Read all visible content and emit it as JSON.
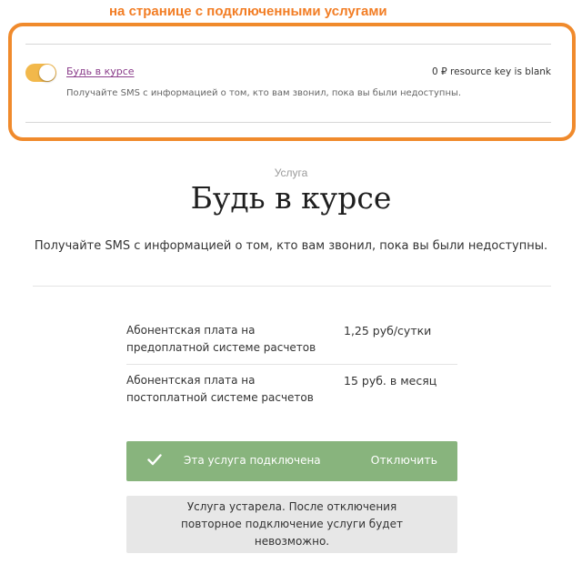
{
  "annotation": {
    "text": "на странице с подключенными услугами",
    "color": "#f27d24"
  },
  "service_row": {
    "toggle_on": true,
    "toggle_color": "#f2b84b",
    "link_label": "Будь в курсе",
    "price_text": "0 ₽ resource key is blank",
    "description": "Получайте SMS с информацией о том, кто вам звонил, пока вы были недоступны."
  },
  "service": {
    "label": "Услуга",
    "title": "Будь в курсе",
    "description": "Получайте SMS с информацией о том, кто вам звонил, пока вы были недоступны."
  },
  "prices": [
    {
      "label": "Абонентская плата на предоплатной системе расчетов",
      "value": "1,25 руб/сутки"
    },
    {
      "label": "Абонентская плата на постоплатной системе расчетов",
      "value": "15 руб. в месяц"
    }
  ],
  "status": {
    "icon": "check-icon",
    "text": "Эта услуга подключена",
    "action_label": "Отключить",
    "color": "#88b47d"
  },
  "notice": {
    "text": "Услуга устарела. После отключения повторное подключение услуги будет невозможно."
  }
}
